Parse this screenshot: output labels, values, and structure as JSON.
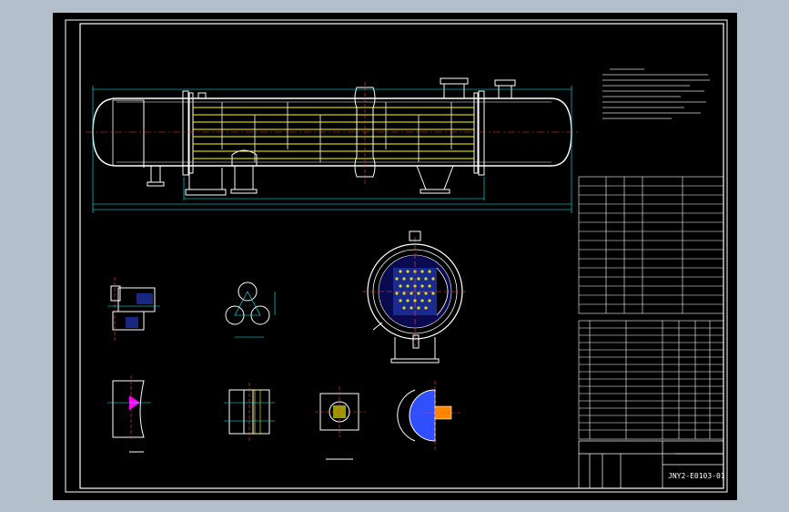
{
  "drawing": {
    "number": "JNY2-E0103-01"
  },
  "colors": {
    "background": "#000000",
    "frame": "#ffffff",
    "shell": "#ffffff",
    "tubes": "#ffff00",
    "dimensions": "#00ffff",
    "centerlines": "#ff4040",
    "hatch": "#3050ff",
    "flange": "#ff00ff"
  },
  "icons": {
    "cursor": "crosshair-icon"
  }
}
